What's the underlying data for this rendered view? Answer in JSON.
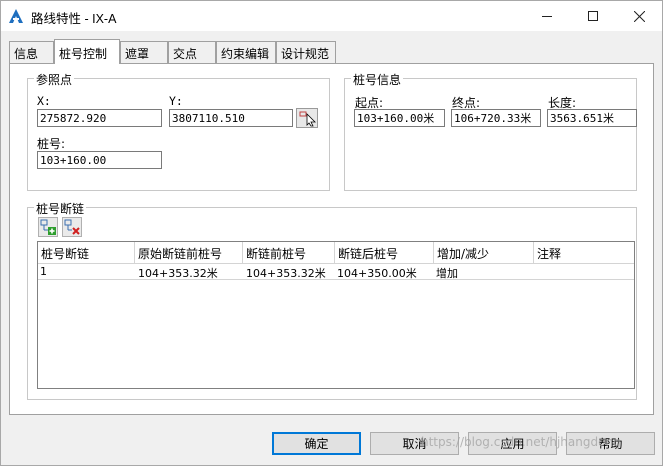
{
  "window": {
    "title": "路线特性 - IX-A"
  },
  "tabs": [
    {
      "label": "信息"
    },
    {
      "label": "桩号控制"
    },
    {
      "label": "遮罩"
    },
    {
      "label": "交点"
    },
    {
      "label": "约束编辑"
    },
    {
      "label": "设计规范"
    }
  ],
  "active_tab": "桩号控制",
  "reference_point": {
    "group_title": "参照点",
    "x_label": "X:",
    "x_value": "275872.920",
    "y_label": "Y:",
    "y_value": "3807110.510",
    "station_label": "桩号:",
    "station_value": "103+160.00"
  },
  "station_info": {
    "group_title": "桩号信息",
    "start_label": "起点:",
    "start_value": "103+160.00米",
    "end_label": "终点:",
    "end_value": "106+720.33米",
    "length_label": "长度:",
    "length_value": "3563.651米"
  },
  "station_equations": {
    "group_title": "桩号断链",
    "columns": [
      "桩号断链",
      "原始断链前桩号",
      "断链前桩号",
      "断链后桩号",
      "增加/减少",
      "注释"
    ],
    "rows": [
      {
        "id": "1",
        "raw_back": "104+353.32米",
        "back": "104+353.32米",
        "ahead": "104+350.00米",
        "direction": "增加",
        "note": ""
      }
    ]
  },
  "buttons": {
    "ok": "确定",
    "cancel": "取消",
    "apply": "应用",
    "help": "帮助"
  },
  "watermark": "https://blog.csdn.net/hjhangdong",
  "icons": {
    "app": "civil3d-a-icon",
    "pick": "pick-point-icon",
    "add": "add-equation-icon",
    "delete": "delete-equation-icon"
  },
  "colors": {
    "accent": "#0078d7",
    "app_icon": "#1f6fbf"
  }
}
